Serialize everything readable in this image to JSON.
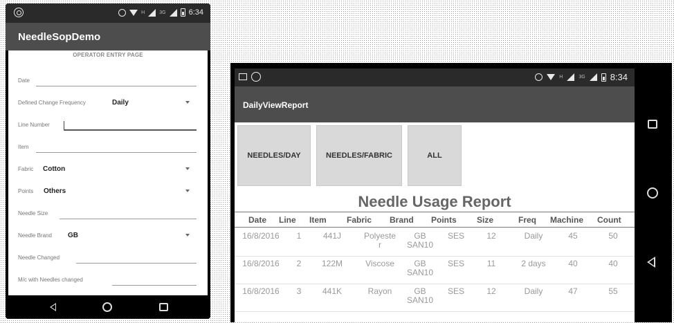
{
  "left_phone": {
    "status": {
      "time": "6:34",
      "network": "3G",
      "network_h": "H"
    },
    "app_title": "NeedleSopDemo",
    "page_title": "OPERATOR ENTRY PAGE",
    "fields": {
      "date": {
        "label": "Date",
        "value": ""
      },
      "frequency": {
        "label": "Defined Change Frequency",
        "value": "Daily"
      },
      "line_number": {
        "label": "Line Number",
        "value": ""
      },
      "item": {
        "label": "Item",
        "value": ""
      },
      "fabric": {
        "label": "Fabric",
        "value": "Cotton"
      },
      "points": {
        "label": "Points",
        "value": "Others"
      },
      "needle_size": {
        "label": "Needle Size",
        "value": ""
      },
      "needle_brand": {
        "label": "Needle Brand",
        "value": "GB"
      },
      "needle_changed": {
        "label": "Needle Changed",
        "value": ""
      },
      "mc_changed": {
        "label": "M/c with Needles changed",
        "value": ""
      }
    }
  },
  "right_phone": {
    "status": {
      "time": "8:34",
      "network": "3G",
      "network_h": "H"
    },
    "app_title": "DailyViewReport",
    "buttons": {
      "per_day": "NEEDLES/DAY",
      "per_fabric": "NEEDLES/FABRIC",
      "all": "ALL"
    },
    "report_title": "Needle Usage Report",
    "table": {
      "headers": [
        "Date",
        "Line",
        "Item",
        "Fabric",
        "Brand",
        "Points",
        "Size",
        "Freq",
        "Machine",
        "Count"
      ],
      "rows": [
        [
          "16/8/2016",
          "1",
          "441J",
          "Polyeste\nr",
          "GB\nSAN10",
          "SES",
          "12",
          "Daily",
          "45",
          "50"
        ],
        [
          "16/8/2016",
          "2",
          "122M",
          "Viscose",
          "GB\nSAN10",
          "SES",
          "11",
          "2 days",
          "40",
          "40"
        ],
        [
          "16/8/2016",
          "3",
          "441K",
          "Rayon",
          "GB\nSAN10",
          "SES",
          "12",
          "Daily",
          "47",
          "55"
        ]
      ]
    }
  }
}
